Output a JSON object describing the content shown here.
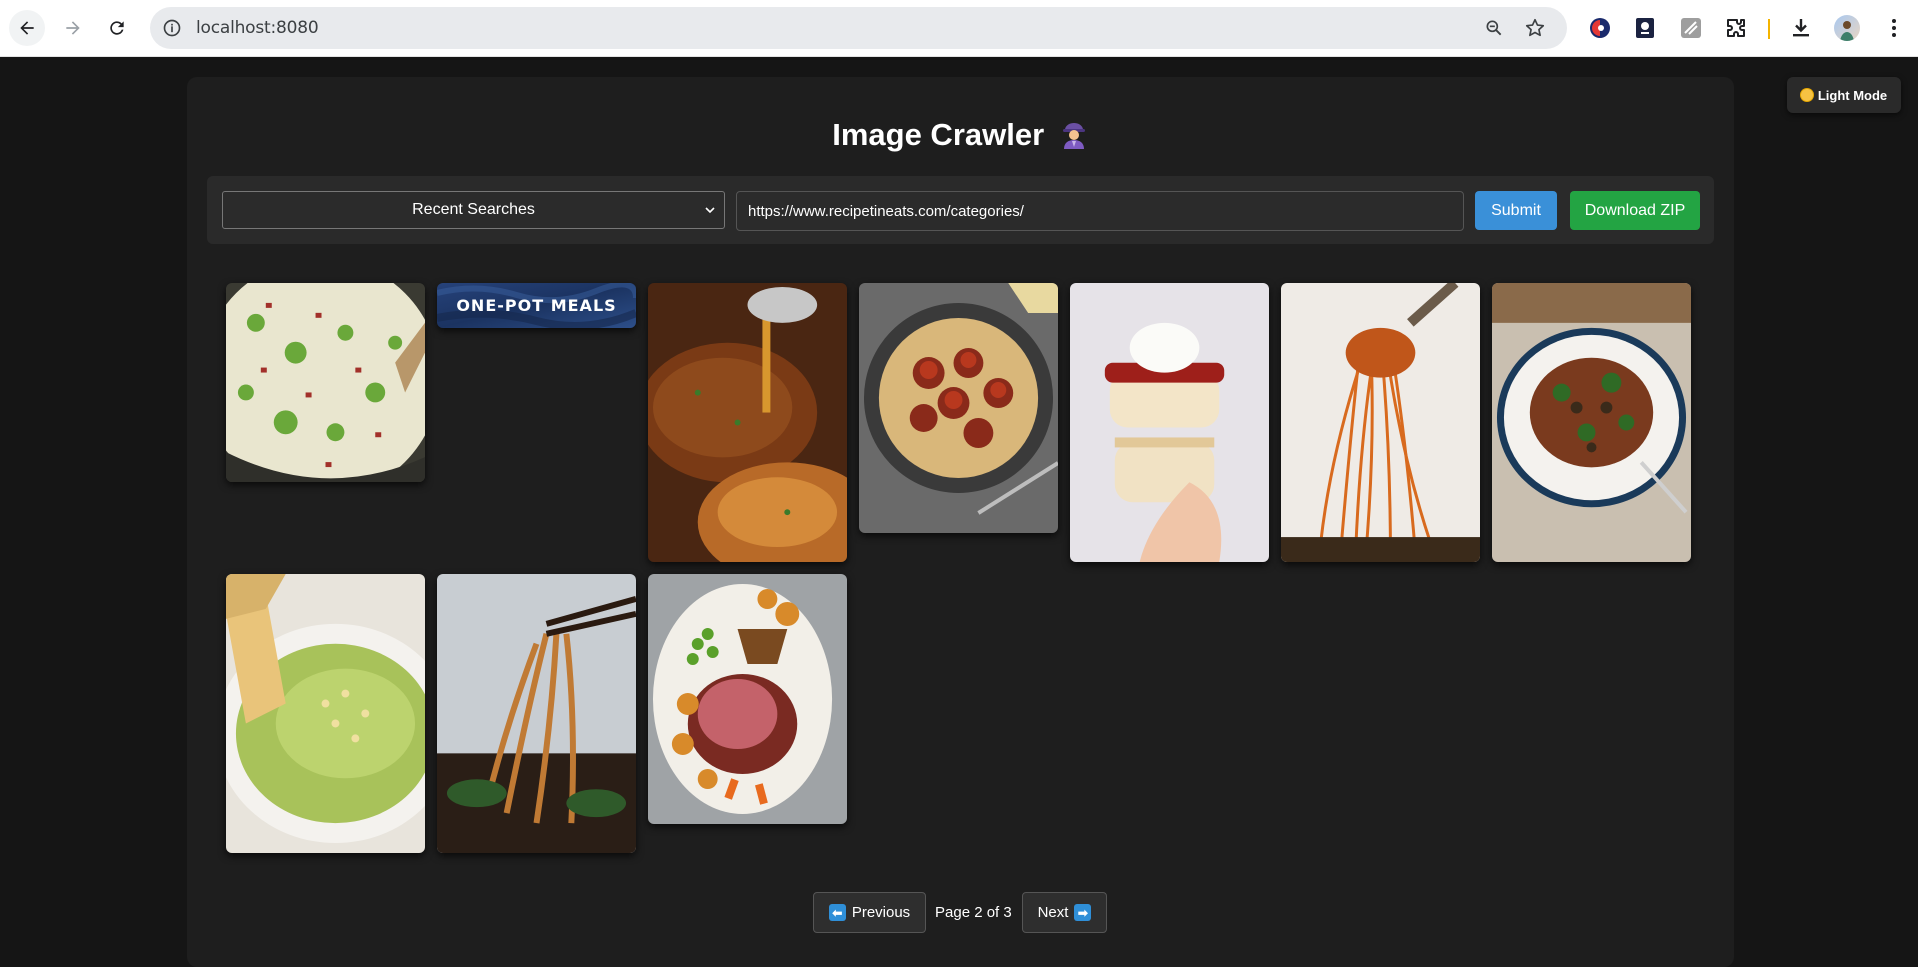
{
  "browser": {
    "url": "localhost:8080"
  },
  "theme_toggle": {
    "label": "Light Mode"
  },
  "app": {
    "title": "Image Crawler",
    "title_emoji": "detective-icon"
  },
  "controls": {
    "recent_searches_label": "Recent Searches",
    "url_value": "https://www.recipetineats.com/categories/",
    "submit_label": "Submit",
    "download_label": "Download ZIP"
  },
  "gallery": {
    "images": [
      {
        "name": "broccoli-soup",
        "banner_text": ""
      },
      {
        "name": "one-pot-meals-banner",
        "banner_text": "ONE-POT MEALS"
      },
      {
        "name": "glazed-chicken",
        "banner_text": ""
      },
      {
        "name": "spaghetti-meatballs",
        "banner_text": ""
      },
      {
        "name": "scones-jam-cream",
        "banner_text": ""
      },
      {
        "name": "spaghetti-fork",
        "banner_text": ""
      },
      {
        "name": "pasta-plate",
        "banner_text": ""
      },
      {
        "name": "avocado-dip",
        "banner_text": ""
      },
      {
        "name": "noodles-chopsticks",
        "banner_text": ""
      },
      {
        "name": "roast-beef-platter",
        "banner_text": ""
      }
    ]
  },
  "pagination": {
    "previous_label": "Previous",
    "page_text": "Page 2 of 3",
    "next_label": "Next"
  }
}
